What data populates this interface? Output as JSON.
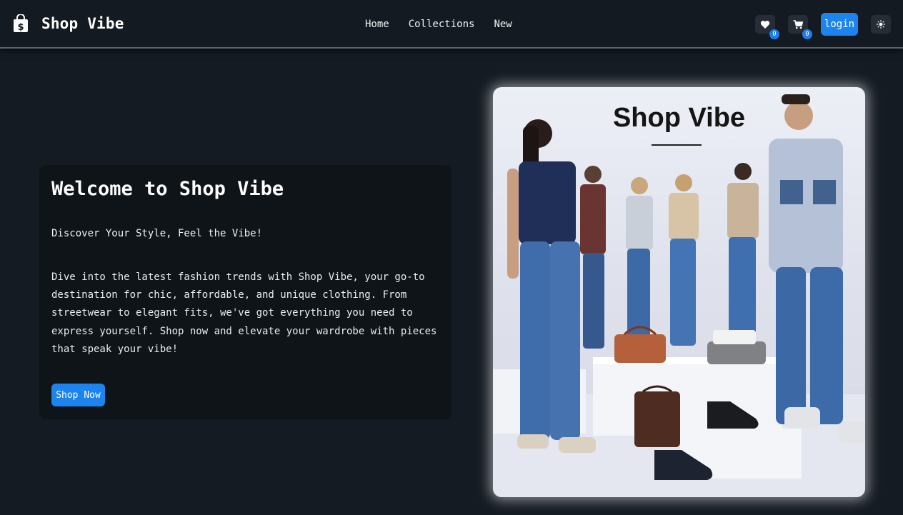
{
  "brand": {
    "name": "Shop Vibe",
    "icon": "shopping-bag-icon"
  },
  "nav": {
    "links": [
      "Home",
      "Collections",
      "New"
    ]
  },
  "header_actions": {
    "wishlist_icon": "heart-icon",
    "wishlist_count": "0",
    "cart_icon": "cart-icon",
    "cart_count": "0",
    "login_label": "login",
    "theme_icon": "sun-icon"
  },
  "hero": {
    "title": "Welcome to Shop Vibe",
    "tagline": "Discover Your Style, Feel the Vibe!",
    "description": "Dive into the latest fashion trends with Shop Vibe, your go-to destination for chic, affordable, and unique clothing. From streetwear to elegant fits, we've got everything you need to express yourself. Shop now and elevate your wardrobe with pieces that speak your vibe!",
    "cta_label": "Shop Now"
  },
  "hero_image": {
    "heading": "Shop Vibe"
  },
  "colors": {
    "background": "#151b22",
    "navbar": "#141a21",
    "card": "#0f1419",
    "accent": "#1d84ee"
  }
}
